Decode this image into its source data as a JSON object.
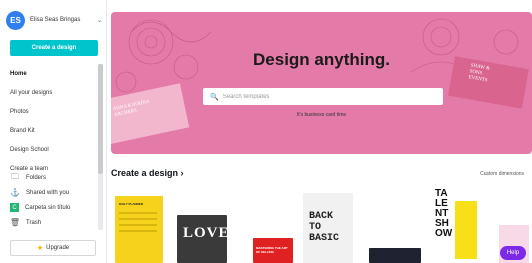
{
  "account": {
    "initials": "ES",
    "name": "Elisa Seas Bringas"
  },
  "sidebar": {
    "create_label": "Create a design",
    "nav": [
      "Home",
      "All your designs",
      "Photos",
      "Brand Kit",
      "Design School",
      "Create a team"
    ],
    "sections": [
      {
        "label": "Folders",
        "icon": "folder-icon"
      },
      {
        "label": "Shared with you",
        "icon": "shared-icon"
      },
      {
        "label": "Carpeta sin título",
        "icon": "green-folder-icon"
      },
      {
        "label": "Trash",
        "icon": "trash-icon"
      }
    ],
    "upgrade_label": "Upgrade"
  },
  "hero": {
    "title": "Design anything.",
    "search_placeholder": "Search templates",
    "subtitle": "It's business card time",
    "card_left_text": "ANNA KATRINA\nARCHERS",
    "card_right_text": "SHAW &\nSONS\nEVENTS"
  },
  "create_section": {
    "title": "Create a design",
    "custom_dimensions": "Custom dimensions"
  },
  "templates": [
    {
      "name": "daily-planner-template",
      "title": "DAILY PLANNER",
      "color": "#f7d21d"
    },
    {
      "name": "love-poster-template",
      "title": "LOVE",
      "color": "#3a3a3a"
    },
    {
      "name": "red-book-cover-template",
      "title": "MASTERING THE ART OF SELLING",
      "color": "#e02121"
    },
    {
      "name": "back-to-basic-template",
      "title": "BACK TO BASIC",
      "color": "#f1f1f1"
    },
    {
      "name": "dark-card-template",
      "title": "",
      "color": "#1f2230"
    },
    {
      "name": "talent-show-template",
      "title": "TA LE NT SH OW",
      "color": "#ffffff"
    },
    {
      "name": "pink-card-template",
      "title": "",
      "color": "#f7d9e7"
    }
  ],
  "help_label": "Help",
  "colors": {
    "brand": "#00c4cc",
    "hero": "#e47aa7",
    "help": "#7d2ae8"
  }
}
